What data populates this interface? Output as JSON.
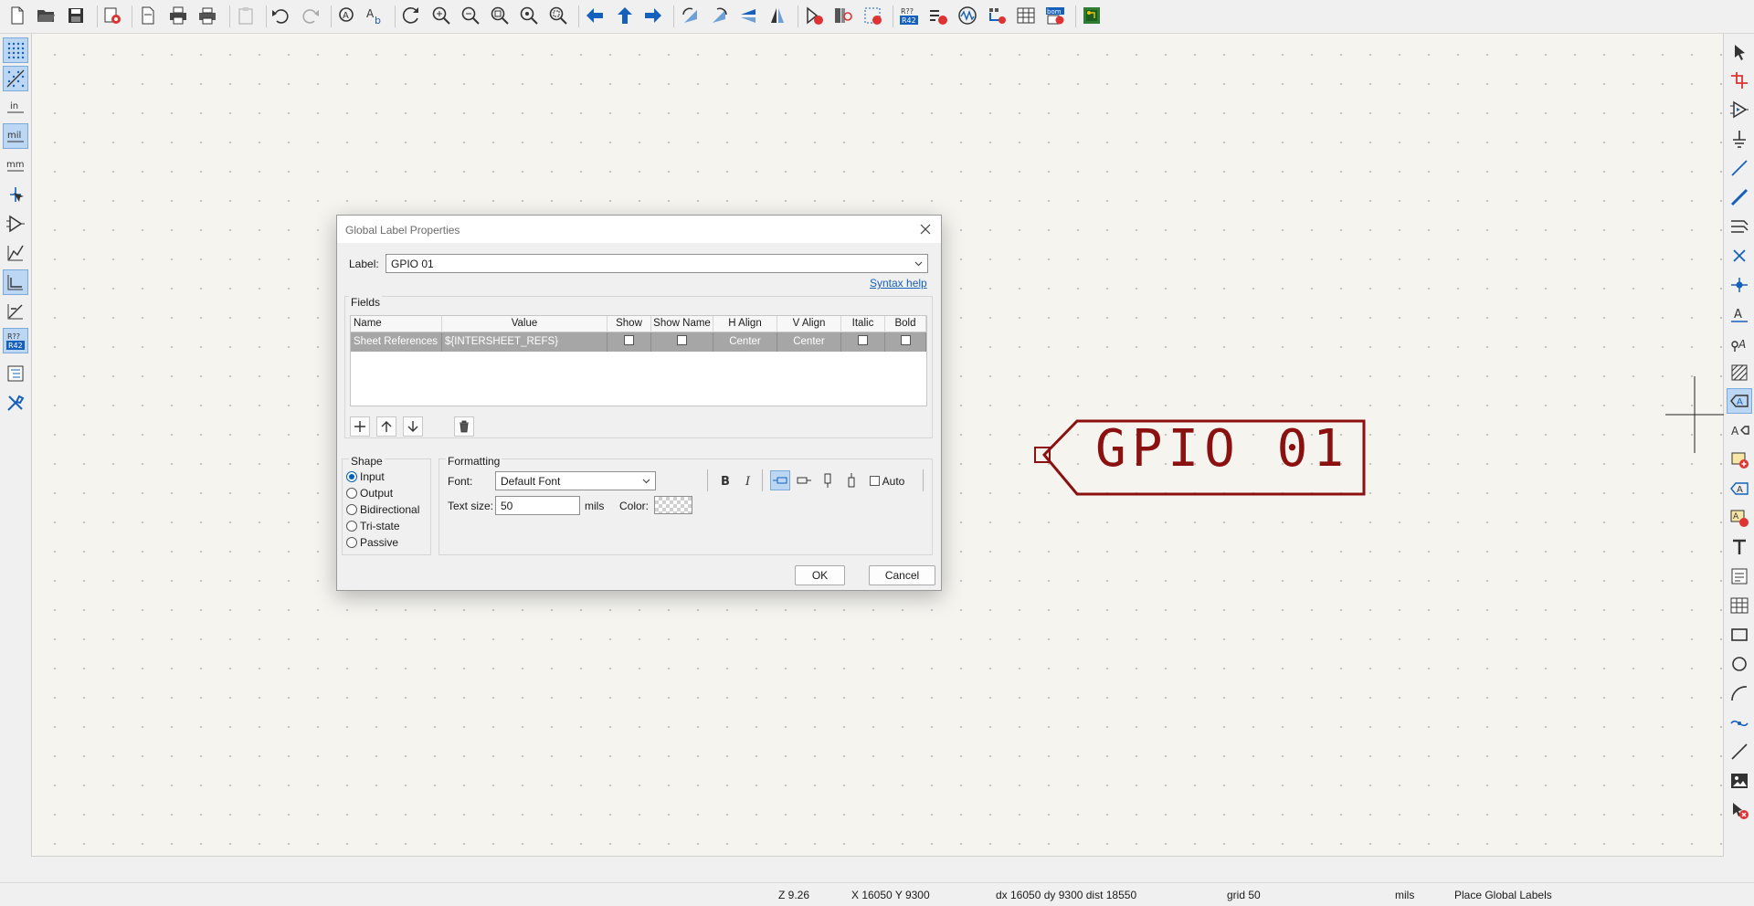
{
  "toolbar": {
    "buttons": [
      "new-icon",
      "open-icon",
      "save-icon",
      "schematic-setup-icon",
      "page-settings-icon",
      "print-icon",
      "plot-icon",
      "paste-icon",
      "undo-icon",
      "redo-icon",
      "find-icon",
      "find-replace-icon",
      "refresh-icon",
      "zoom-in-icon",
      "zoom-out-icon",
      "zoom-fit-icon",
      "zoom-objects-icon",
      "zoom-selection-icon",
      "navigate-back-icon",
      "navigate-up-icon",
      "navigate-forward-icon",
      "rotate-ccw-icon",
      "rotate-cw-icon",
      "mirror-vertical-icon",
      "mirror-horizontal-icon",
      "symbol-editor-icon",
      "symbol-browser-icon",
      "footprint-assign-icon",
      "annotate-icon",
      "erc-icon",
      "simulator-icon",
      "bus-definitions-icon",
      "bom-table-icon",
      "bom-export-icon",
      "pcb-editor-icon"
    ]
  },
  "left_toolbar": {
    "buttons": [
      "grid-dots-icon",
      "grid-overrides-icon",
      "units-inch-icon",
      "units-mil-icon",
      "units-mm-icon",
      "cursor-cross-icon",
      "hidden-pins-icon",
      "free-angle-wires-icon",
      "ortho-wires-icon",
      "45-degree-wires-icon",
      "annotation-icon",
      "hierarchy-navigator-icon",
      "properties-panel-icon"
    ],
    "labels": {
      "in": "in",
      "mil": "mil",
      "mm": "mm",
      "annot_top": "R??",
      "annot_bottom": "R42"
    }
  },
  "right_toolbar": {
    "buttons": [
      "select-icon",
      "highlight-net-icon",
      "add-symbol-icon",
      "add-power-icon",
      "add-wire-icon",
      "add-bus-icon",
      "add-bus-entry-icon",
      "no-connect-icon",
      "add-junction-icon",
      "add-label-icon",
      "add-netclass-icon",
      "add-rule-area-icon",
      "add-global-label-icon",
      "add-hier-label-icon",
      "add-sheet-icon",
      "import-sheet-pin-icon",
      "sync-sheet-pins-icon",
      "add-text-icon",
      "add-textbox-icon",
      "add-table-icon",
      "add-rectangle-icon",
      "add-circle-icon",
      "add-arc-icon",
      "add-bezier-icon",
      "add-line-icon",
      "add-image-icon",
      "delete-tool-icon"
    ]
  },
  "canvas": {
    "label_text": "GPIO 01",
    "label_color": "#8b1010"
  },
  "dialog": {
    "title": "Global Label Properties",
    "label_caption": "Label:",
    "label_value": "GPIO 01",
    "syntax_help": "Syntax help",
    "fields_caption": "Fields",
    "columns": [
      "Name",
      "Value",
      "Show",
      "Show Name",
      "H Align",
      "V Align",
      "Italic",
      "Bold"
    ],
    "rows": [
      {
        "name": "Sheet References",
        "value": "${INTERSHEET_REFS}",
        "show": false,
        "show_name": false,
        "h_align": "Center",
        "v_align": "Center",
        "italic": false,
        "bold": false
      }
    ],
    "shape_caption": "Shape",
    "shapes": [
      "Input",
      "Output",
      "Bidirectional",
      "Tri-state",
      "Passive"
    ],
    "selected_shape": "Input",
    "formatting_caption": "Formatting",
    "font_caption": "Font:",
    "font_value": "Default Font",
    "auto_label": "Auto",
    "text_size_caption": "Text size:",
    "text_size_value": "50",
    "text_size_unit": "mils",
    "color_caption": "Color:",
    "ok": "OK",
    "cancel": "Cancel"
  },
  "status": {
    "zoom": "Z 9.26",
    "xy": "X 16050  Y 9300",
    "delta": "dx 16050  dy 9300  dist 18550",
    "grid": "grid 50",
    "units": "mils",
    "message": "Place Global Labels"
  },
  "colors": {
    "accent": "#1560bd",
    "active_bg": "#bcd7f3",
    "schematic_red": "#8b1010",
    "canvas_bg": "#f5f4ef"
  }
}
